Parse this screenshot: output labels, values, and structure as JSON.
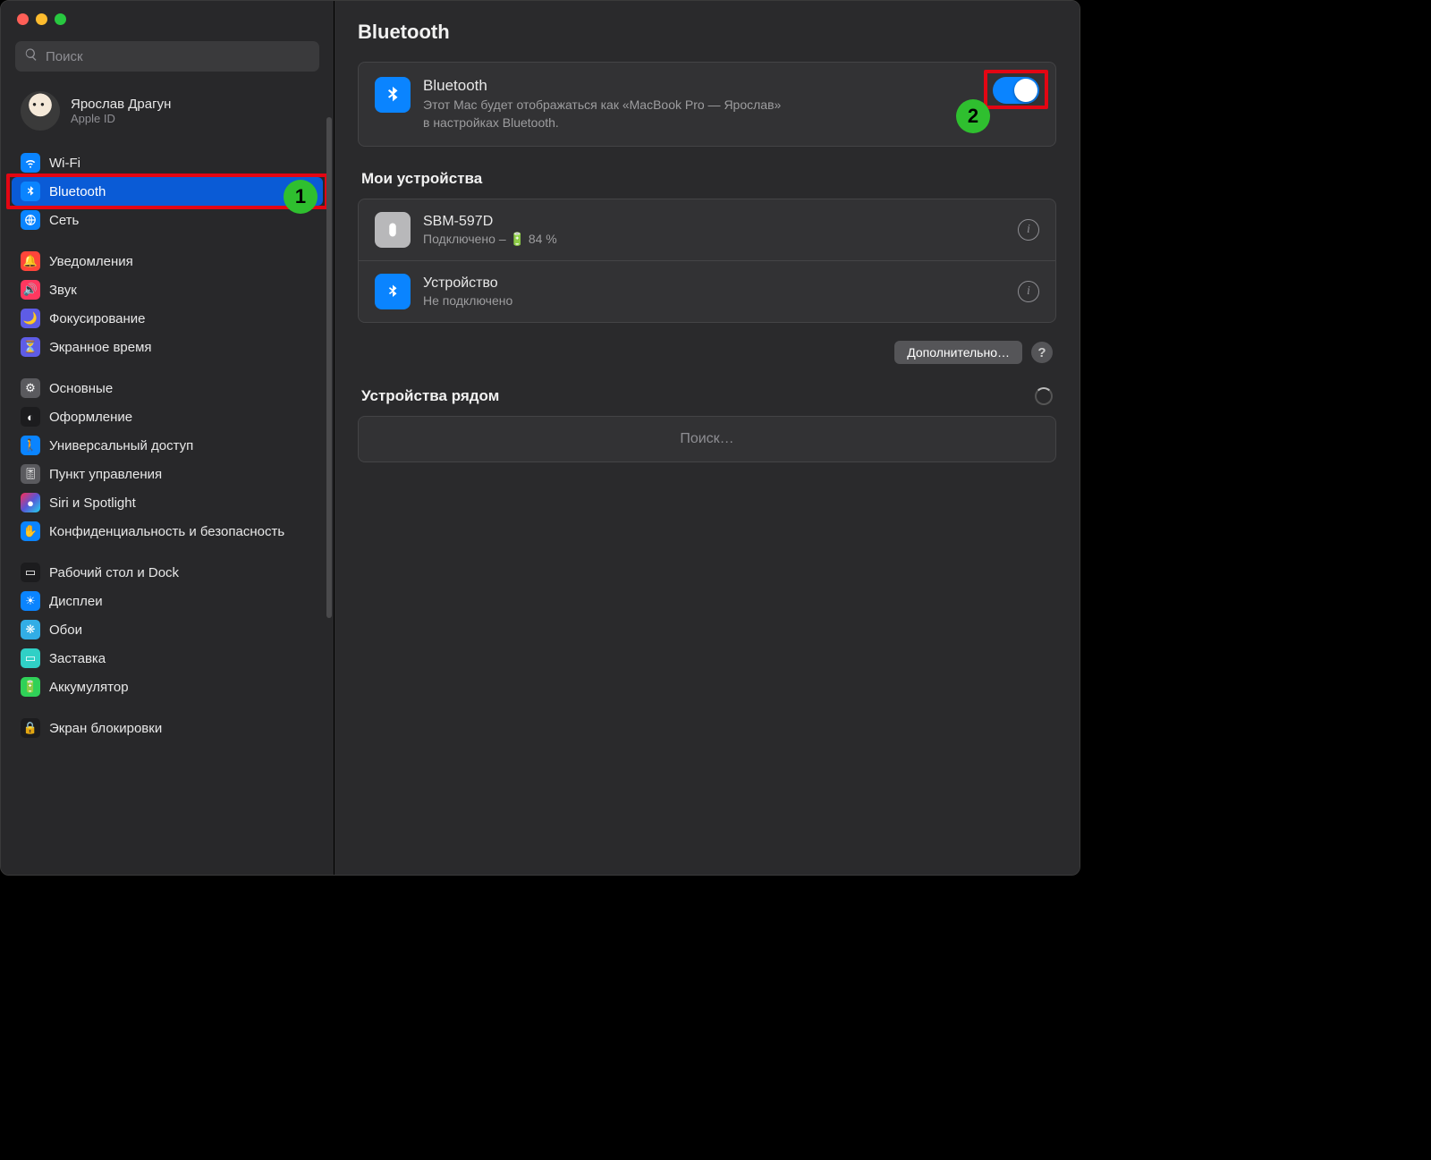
{
  "search": {
    "placeholder": "Поиск"
  },
  "user": {
    "name": "Ярослав Драгун",
    "sub": "Apple ID"
  },
  "sidebar": {
    "groups": [
      [
        {
          "label": "Wi-Fi"
        },
        {
          "label": "Bluetooth"
        },
        {
          "label": "Сеть"
        }
      ],
      [
        {
          "label": "Уведомления"
        },
        {
          "label": "Звук"
        },
        {
          "label": "Фокусирование"
        },
        {
          "label": "Экранное время"
        }
      ],
      [
        {
          "label": "Основные"
        },
        {
          "label": "Оформление"
        },
        {
          "label": "Универсальный доступ"
        },
        {
          "label": "Пункт управления"
        },
        {
          "label": "Siri и Spotlight"
        },
        {
          "label": "Конфиденциальность и безопасность"
        }
      ],
      [
        {
          "label": "Рабочий стол и Dock"
        },
        {
          "label": "Дисплеи"
        },
        {
          "label": "Обои"
        },
        {
          "label": "Заставка"
        },
        {
          "label": "Аккумулятор"
        }
      ],
      [
        {
          "label": "Экран блокировки"
        }
      ]
    ]
  },
  "page": {
    "title": "Bluetooth",
    "bt_card": {
      "title": "Bluetooth",
      "desc1": "Этот Mac будет отображаться как «MacBook Pro — Ярослав»",
      "desc2": "в настройках Bluetooth."
    },
    "my_devices_title": "Мои устройства",
    "devices": [
      {
        "name": "SBM-597D",
        "status": "Подключено – 🔋 84 %"
      },
      {
        "name": "Устройство",
        "status": "Не подключено"
      }
    ],
    "advanced_label": "Дополнительно…",
    "help_label": "?",
    "nearby_title": "Устройства рядом",
    "searching_label": "Поиск…"
  },
  "annotations": {
    "badge1": "1",
    "badge2": "2"
  }
}
